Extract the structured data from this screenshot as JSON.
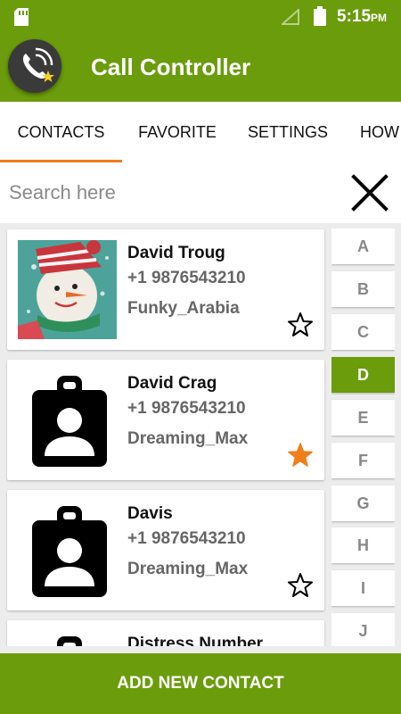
{
  "status_bar": {
    "time": "5:15",
    "ampm": "PM"
  },
  "app": {
    "title": "Call Controller"
  },
  "tabs": [
    {
      "label": "CONTACTS",
      "active": true
    },
    {
      "label": "FAVORITE",
      "active": false
    },
    {
      "label": "SETTINGS",
      "active": false
    },
    {
      "label": "HOW",
      "active": false
    }
  ],
  "search": {
    "placeholder": "Search here",
    "value": ""
  },
  "contacts": [
    {
      "name": "David Troug",
      "phone": "+1 9876543210",
      "ringtone": "Funky_Arabia",
      "avatar": "snowman-photo",
      "favorite": false
    },
    {
      "name": "David Crag",
      "phone": "+1 9876543210",
      "ringtone": "Dreaming_Max",
      "avatar": "contact-placeholder-icon",
      "favorite": true
    },
    {
      "name": "Davis",
      "phone": "+1 9876543210",
      "ringtone": "Dreaming_Max",
      "avatar": "contact-placeholder-icon",
      "favorite": false
    },
    {
      "name": "Distress Number",
      "phone": "",
      "ringtone": "",
      "avatar": "contact-placeholder-icon",
      "favorite": false
    }
  ],
  "alphabet": {
    "letters": [
      "A",
      "B",
      "C",
      "D",
      "E",
      "F",
      "G",
      "H",
      "I",
      "J"
    ],
    "selected": "D"
  },
  "actions": {
    "add_contact": "ADD NEW CONTACT"
  },
  "colors": {
    "primary": "#6a9c0b",
    "accent": "#f07e1a",
    "background": "#ececec"
  }
}
